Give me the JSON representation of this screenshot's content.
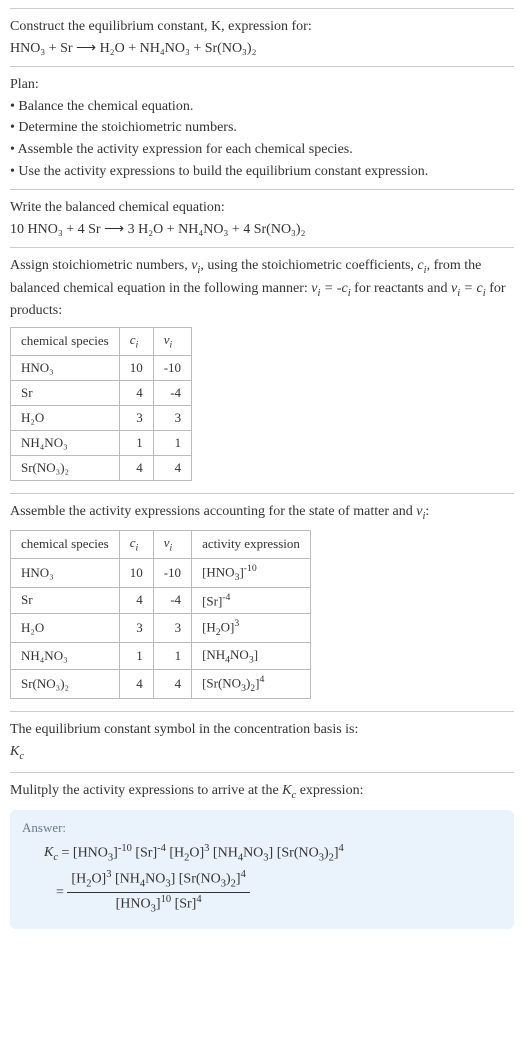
{
  "intro": {
    "l1": "Construct the equilibrium constant, K, expression for:",
    "l2": "HNO₃ + Sr ⟶ H₂O + NH₄NO₃ + Sr(NO₃)₂"
  },
  "plan": {
    "title": "Plan:",
    "b1": "• Balance the chemical equation.",
    "b2": "• Determine the stoichiometric numbers.",
    "b3": "• Assemble the activity expression for each chemical species.",
    "b4": "• Use the activity expressions to build the equilibrium constant expression."
  },
  "balanced": {
    "l1": "Write the balanced chemical equation:",
    "l2": "10 HNO₃ + 4 Sr ⟶ 3 H₂O + NH₄NO₃ + 4 Sr(NO₃)₂"
  },
  "assign": {
    "p1a": "Assign stoichiometric numbers, ",
    "p1b": ", using the stoichiometric coefficients, ",
    "p1c": ", from the balanced chemical equation in the following manner: ",
    "p1d": " for reactants and ",
    "p1e": " for products:"
  },
  "table1": {
    "h1": "chemical species",
    "h2": "cᵢ",
    "h3": "νᵢ",
    "r1": {
      "sp": "HNO₃",
      "c": "10",
      "v": "-10"
    },
    "r2": {
      "sp": "Sr",
      "c": "4",
      "v": "-4"
    },
    "r3": {
      "sp": "H₂O",
      "c": "3",
      "v": "3"
    },
    "r4": {
      "sp": "NH₄NO₃",
      "c": "1",
      "v": "1"
    },
    "r5": {
      "sp": "Sr(NO₃)₂",
      "c": "4",
      "v": "4"
    }
  },
  "assemble": {
    "l1": "Assemble the activity expressions accounting for the state of matter and νᵢ:"
  },
  "table2": {
    "h1": "chemical species",
    "h2": "cᵢ",
    "h3": "νᵢ",
    "h4": "activity expression",
    "r1": {
      "sp": "HNO₃",
      "c": "10",
      "v": "-10"
    },
    "r2": {
      "sp": "Sr",
      "c": "4",
      "v": "-4"
    },
    "r3": {
      "sp": "H₂O",
      "c": "3",
      "v": "3"
    },
    "r4": {
      "sp": "NH₄NO₃",
      "c": "1",
      "v": "1"
    },
    "r5": {
      "sp": "Sr(NO₃)₂",
      "c": "4",
      "v": "4"
    }
  },
  "symbol": {
    "l1": "The equilibrium constant symbol in the concentration basis is:",
    "l2": "K꜀"
  },
  "multiply": {
    "l1a": "Mulitply the activity expressions to arrive at the ",
    "l1b": " expression:"
  },
  "answer": {
    "label": "Answer:"
  }
}
